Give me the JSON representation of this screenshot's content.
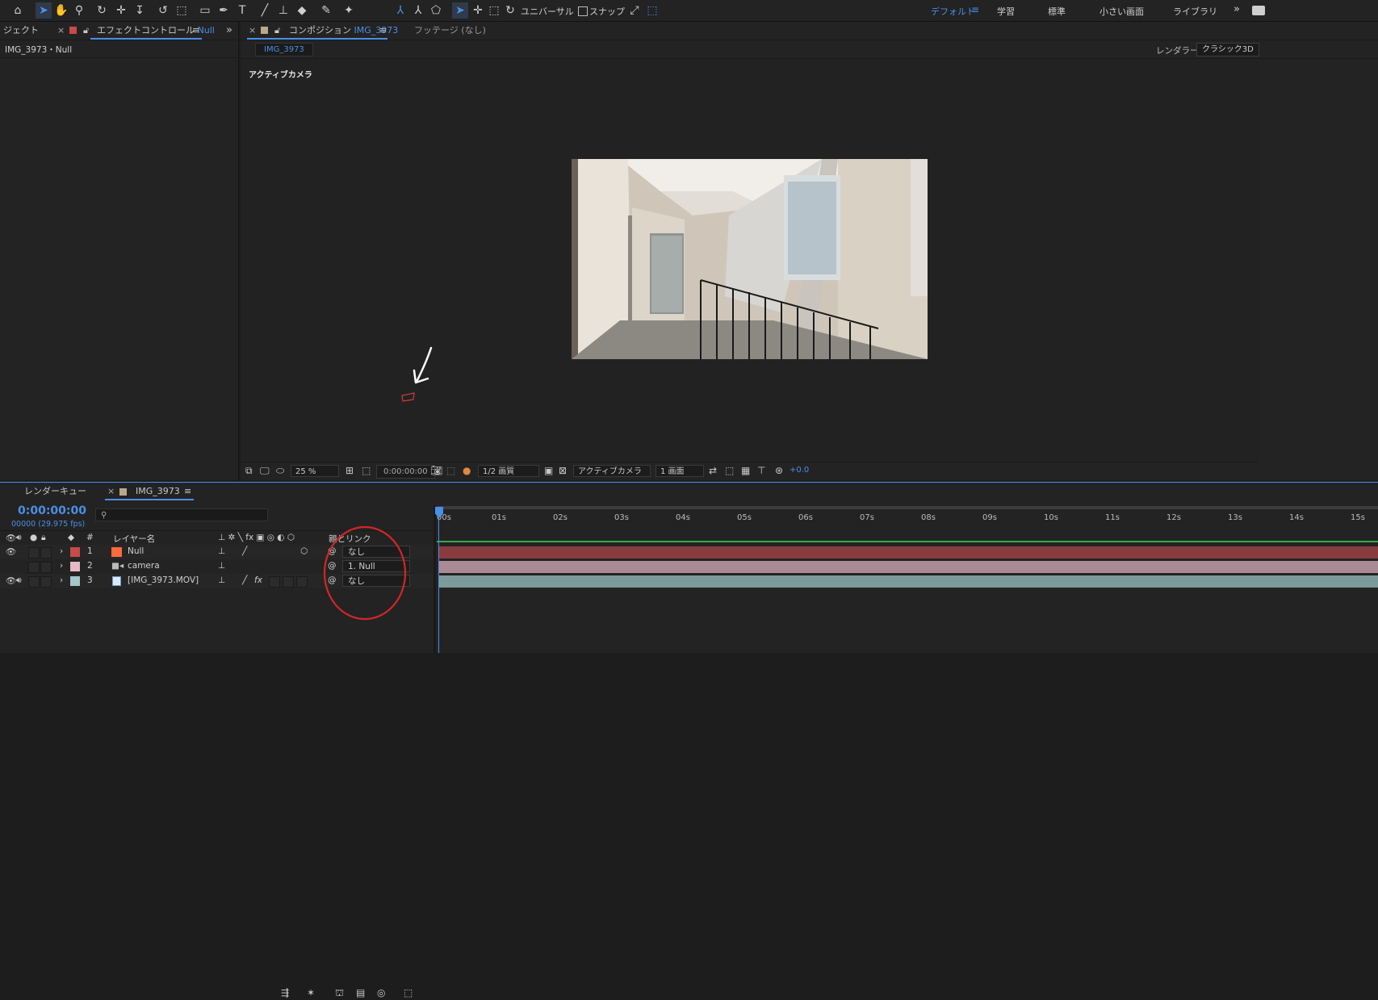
{
  "toolbar": {
    "universal_label": "ユニバーサル",
    "snap_label": "スナップ",
    "workspaces": [
      "デフォルト",
      "学習",
      "標準",
      "小さい画面",
      "ライブラリ"
    ],
    "expand": "»"
  },
  "left_panel": {
    "tab_project": "ジェクト",
    "tab_effects": "エフェクトコントロール",
    "tab_effects_target": "Null",
    "subtitle": "IMG_3973・Null"
  },
  "comp_panel": {
    "tab_label": "コンポジション",
    "tab_name": "IMG_3973",
    "footage_tab": "フッテージ (なし)",
    "subtab": "IMG_3973",
    "renderer_label": "レンダラー：",
    "renderer_value": "クラシック3D",
    "camera_label": "アクティブカメラ",
    "zoom": "25 %",
    "timecode": "0:00:00:00",
    "resolution": "1/2 画質",
    "view": "アクティブカメラ",
    "layout": "1 画面",
    "exposure": "+0.0"
  },
  "timeline": {
    "render_queue_tab": "レンダーキュー",
    "comp_tab": "IMG_3973",
    "timecode": "0:00:00:00",
    "frame_info": "00000 (29.975 fps)",
    "search_placeholder": "",
    "col_num": "#",
    "col_layer_name": "レイヤー名",
    "col_parent": "親とリンク",
    "ruler": [
      "00s",
      "01s",
      "02s",
      "03s",
      "04s",
      "05s",
      "06s",
      "07s",
      "08s",
      "09s",
      "10s",
      "11s",
      "12s",
      "13s",
      "14s",
      "15s"
    ],
    "layers": [
      {
        "num": "1",
        "name": "Null",
        "label_color": "#c84a4a",
        "type_color": "#ff6a3d",
        "parent": "なし",
        "bar_color": "#8a3b40"
      },
      {
        "num": "2",
        "name": "camera",
        "label_color": "#e6b9c4",
        "type_color": "#6b6b6b",
        "parent": "1. Null",
        "bar_color": "#a98a95"
      },
      {
        "num": "3",
        "name": "[IMG_3973.MOV]",
        "label_color": "#a4c8c8",
        "type_color": "#6b9bd8",
        "parent": "なし",
        "bar_color": "#7d9a9a"
      }
    ]
  }
}
